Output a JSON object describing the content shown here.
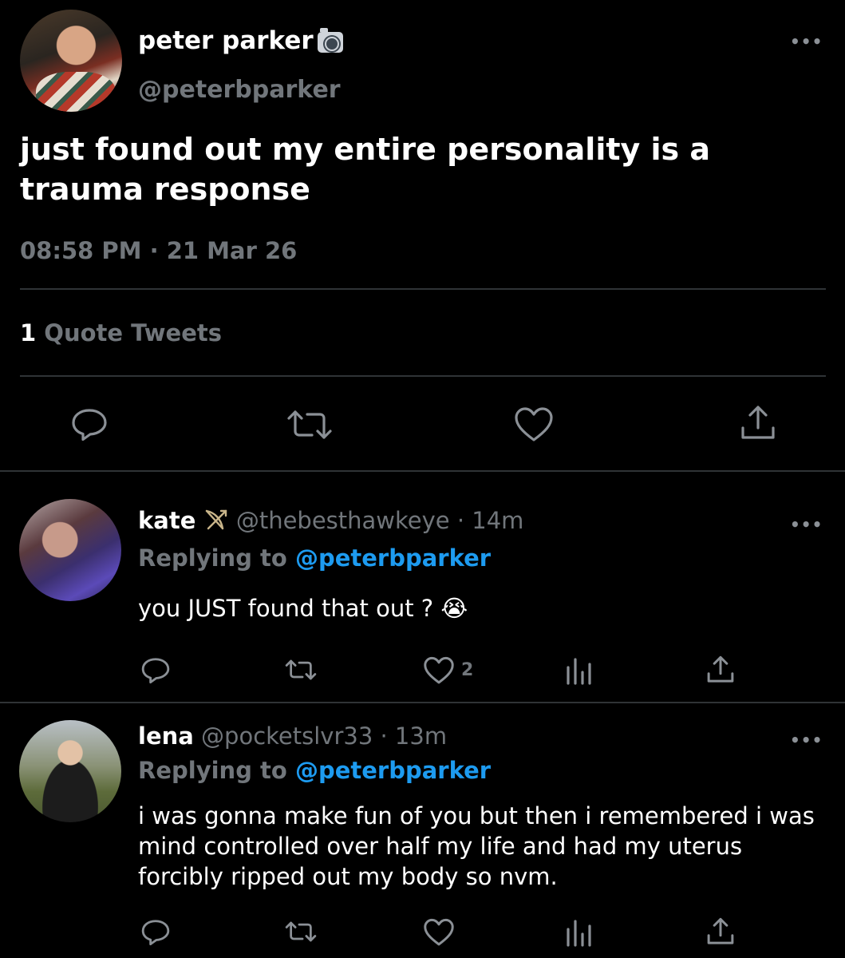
{
  "main_tweet": {
    "name": "peter parker",
    "name_badge_icon": "camera-flash-icon",
    "handle": "@peterbparker",
    "more": "•••",
    "text": "just found out my entire personality is a trauma response",
    "timestamp": "08:58 PM · 21 Mar 26",
    "quote_count": "1",
    "quote_label": "Quote Tweets",
    "actions": [
      "reply-icon",
      "retweet-icon",
      "like-icon",
      "share-icon"
    ]
  },
  "replies": [
    {
      "name": "kate",
      "name_badge_icon": "bow-and-arrow-icon",
      "handle_time": "@thebesthawkeye · 14m",
      "replying_prefix": "Replying to",
      "replying_handle": "@peterbparker",
      "text": "you JUST found that out ?",
      "text_emoji": "😭",
      "like_count": "2",
      "more": "•••"
    },
    {
      "name": "lena",
      "handle_time": "@pocketslvr33 · 13m",
      "replying_prefix": "Replying to",
      "replying_handle": "@peterbparker",
      "text": "i was gonna make fun of you but then i remembered i was mind controlled over half my life and had my uterus forcibly ripped out my body so nvm.",
      "more": "•••"
    }
  ],
  "colors": {
    "background": "#000000",
    "muted": "#71767b",
    "link": "#1d9bf0",
    "divider": "#2f3336"
  }
}
